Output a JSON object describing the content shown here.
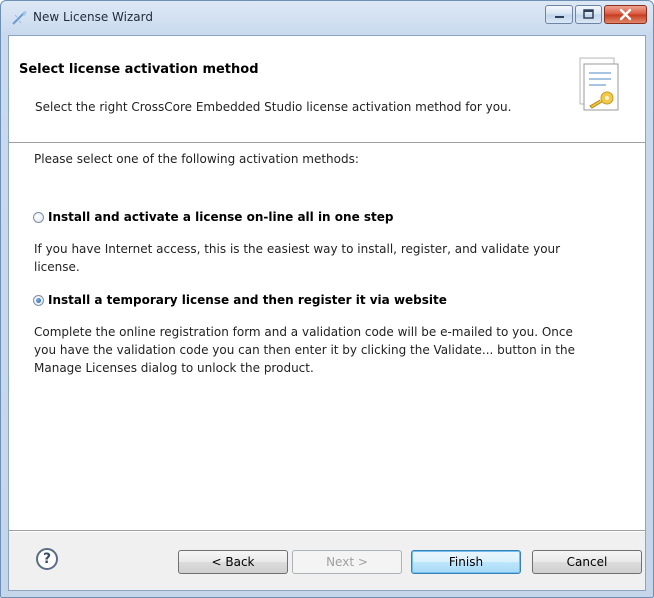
{
  "window": {
    "title": "New License Wizard"
  },
  "banner": {
    "title": "Select license activation method",
    "subtitle": "Select the right CrossCore Embedded Studio license activation method for you."
  },
  "content": {
    "instruction": "Please select one of the following activation methods:",
    "options": [
      {
        "label": "Install and activate a license on-line all in one step",
        "description_lines": [
          "If you have Internet access, this is the easiest way to install, register, and validate your",
          "license."
        ],
        "selected": false
      },
      {
        "label": "Install a temporary license and then register it via website",
        "description_lines": [
          "Complete the online registration form and a validation code will be e-mailed to you. Once",
          "you have the validation code you can then enter it by clicking the Validate... button in the",
          "Manage Licenses dialog to unlock the product."
        ],
        "selected": true
      }
    ]
  },
  "footer": {
    "help_glyph": "?",
    "back_label": "< Back",
    "next_label": "Next >",
    "finish_label": "Finish",
    "cancel_label": "Cancel"
  },
  "colors": {
    "titlebar": "#c9daee",
    "close_button": "#c63a1e",
    "default_button_border": "#3c7fb1",
    "radio_selected": "#1d5aa6"
  }
}
